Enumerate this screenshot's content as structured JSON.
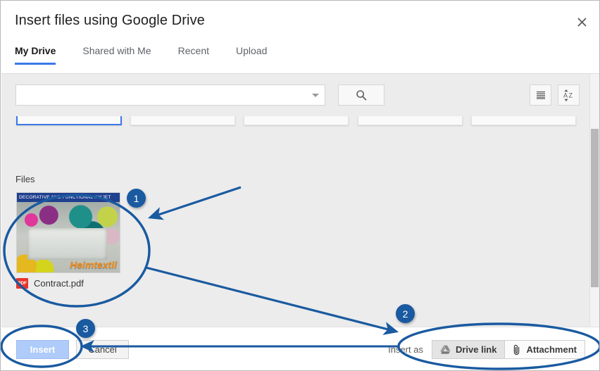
{
  "dialog": {
    "title": "Insert files using Google Drive",
    "close_icon": "close-icon"
  },
  "tabs": [
    {
      "label": "My Drive",
      "active": true
    },
    {
      "label": "Shared with Me",
      "active": false
    },
    {
      "label": "Recent",
      "active": false
    },
    {
      "label": "Upload",
      "active": false
    }
  ],
  "search": {
    "value": "",
    "placeholder": "",
    "dropdown_icon": "chevron-down-icon",
    "search_icon": "search-icon"
  },
  "view_toggles": [
    {
      "icon": "list-view-icon"
    },
    {
      "icon": "sort-az-icon"
    }
  ],
  "content": {
    "files_label": "Files",
    "file": {
      "name": "Contract.pdf",
      "type_badge": "PDF",
      "thumbnail_banner": "DECORATIVE AND FUNCTIONAL INKJET",
      "thumbnail_brand": "Heimtextil"
    }
  },
  "footer": {
    "insert_label": "Insert",
    "cancel_label": "Cancel",
    "insert_as_label": "Insert as",
    "options": [
      {
        "label": "Drive link",
        "icon": "google-drive-icon",
        "selected": true
      },
      {
        "label": "Attachment",
        "icon": "paperclip-icon",
        "selected": false
      }
    ]
  },
  "annotations": {
    "badges": [
      {
        "number": "1"
      },
      {
        "number": "2"
      },
      {
        "number": "3"
      }
    ],
    "accent_color": "#1a5aa0"
  }
}
